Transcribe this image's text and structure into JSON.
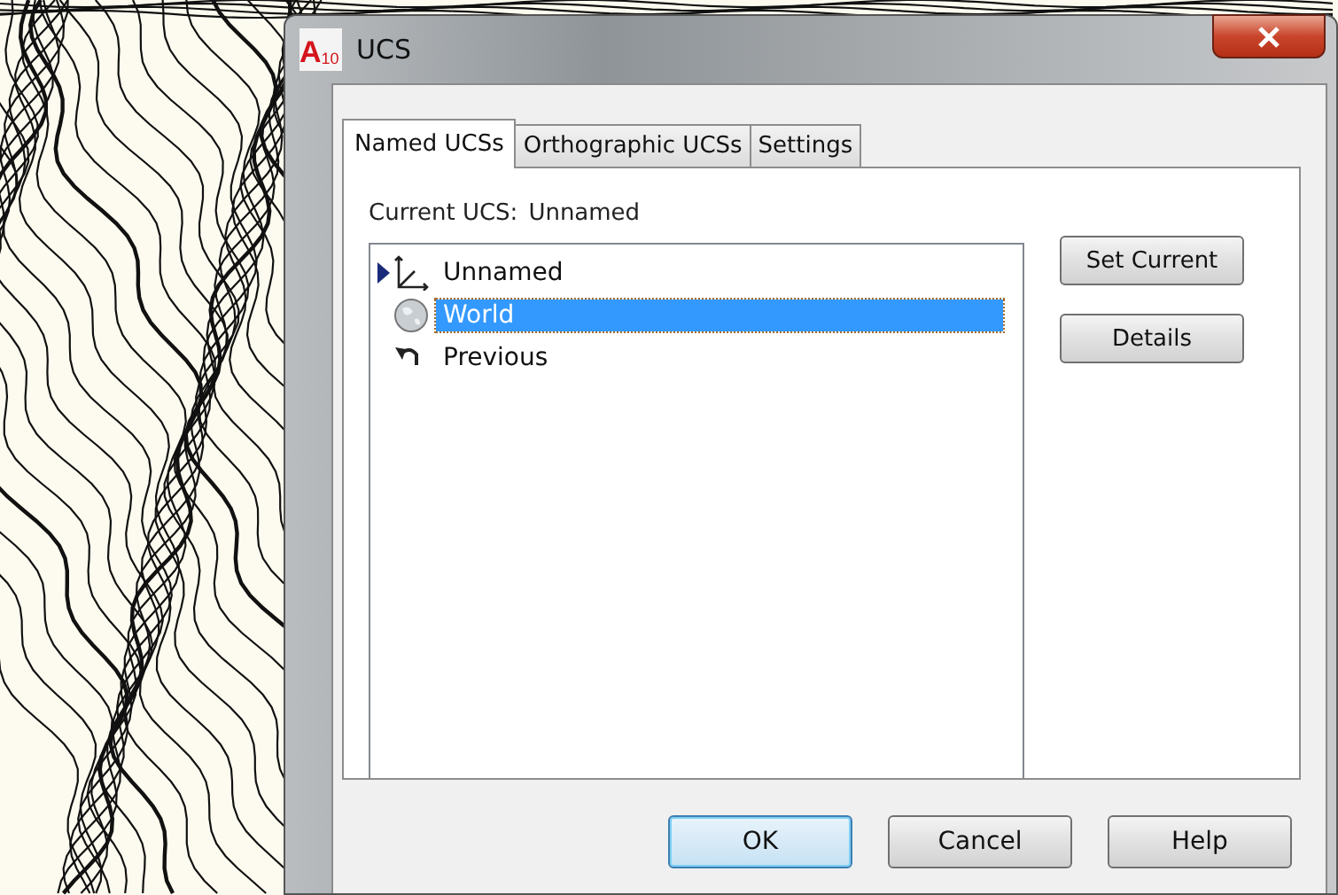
{
  "window": {
    "logo": {
      "mark": "A",
      "version": "10"
    },
    "title": "UCS"
  },
  "tabs": [
    {
      "label": "Named UCSs",
      "selected": true
    },
    {
      "label": "Orthographic UCSs",
      "selected": false
    },
    {
      "label": "Settings",
      "selected": false
    }
  ],
  "current_ucs": {
    "label": "Current UCS:",
    "value": "Unnamed"
  },
  "ucs_list": [
    {
      "name": "Unnamed",
      "kind": "axes",
      "current": true,
      "selected": false
    },
    {
      "name": "World",
      "kind": "globe",
      "current": false,
      "selected": true
    },
    {
      "name": "Previous",
      "kind": "undo",
      "current": false,
      "selected": false
    }
  ],
  "side_buttons": [
    "Set Current",
    "Details"
  ],
  "buttons": [
    {
      "label": "OK",
      "default": true
    },
    {
      "label": "Cancel",
      "default": false
    },
    {
      "label": "Help",
      "default": false
    }
  ]
}
